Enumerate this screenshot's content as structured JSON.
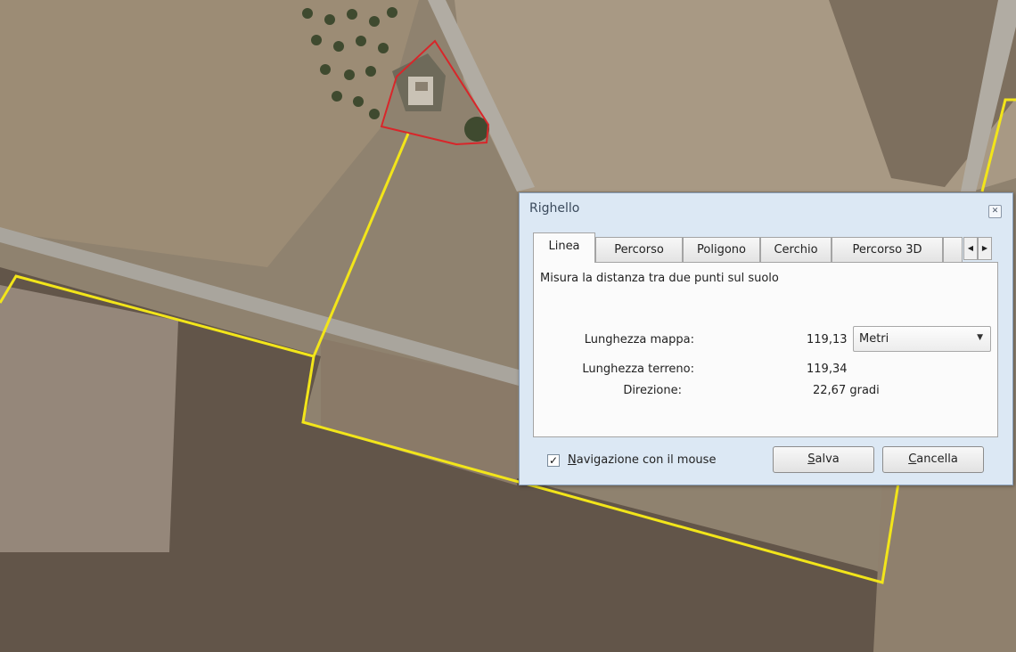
{
  "dialog": {
    "title": "Righello",
    "close_icon": "close-icon"
  },
  "tabs": [
    {
      "label": "Linea",
      "active": true
    },
    {
      "label": "Percorso",
      "active": false
    },
    {
      "label": "Poligono",
      "active": false
    },
    {
      "label": "Cerchio",
      "active": false
    },
    {
      "label": "Percorso 3D",
      "active": false
    }
  ],
  "panel": {
    "description": "Misura la distanza tra due punti sul suolo",
    "map_length_label": "Lunghezza mappa:",
    "map_length_value": "119,13",
    "unit_selected": "Metri",
    "ground_length_label": "Lunghezza terreno:",
    "ground_length_value": "119,34",
    "direction_label": "Direzione:",
    "direction_value": "22,67 gradi"
  },
  "footer": {
    "mouse_nav_checked": true,
    "mouse_nav_first": "N",
    "mouse_nav_rest": "avigazione con il mouse",
    "save_first": "S",
    "save_rest": "alva",
    "cancel_first": "C",
    "cancel_rest": "ancella"
  },
  "colors": {
    "boundary": "#f2e51a",
    "selection": "#d8262a"
  }
}
